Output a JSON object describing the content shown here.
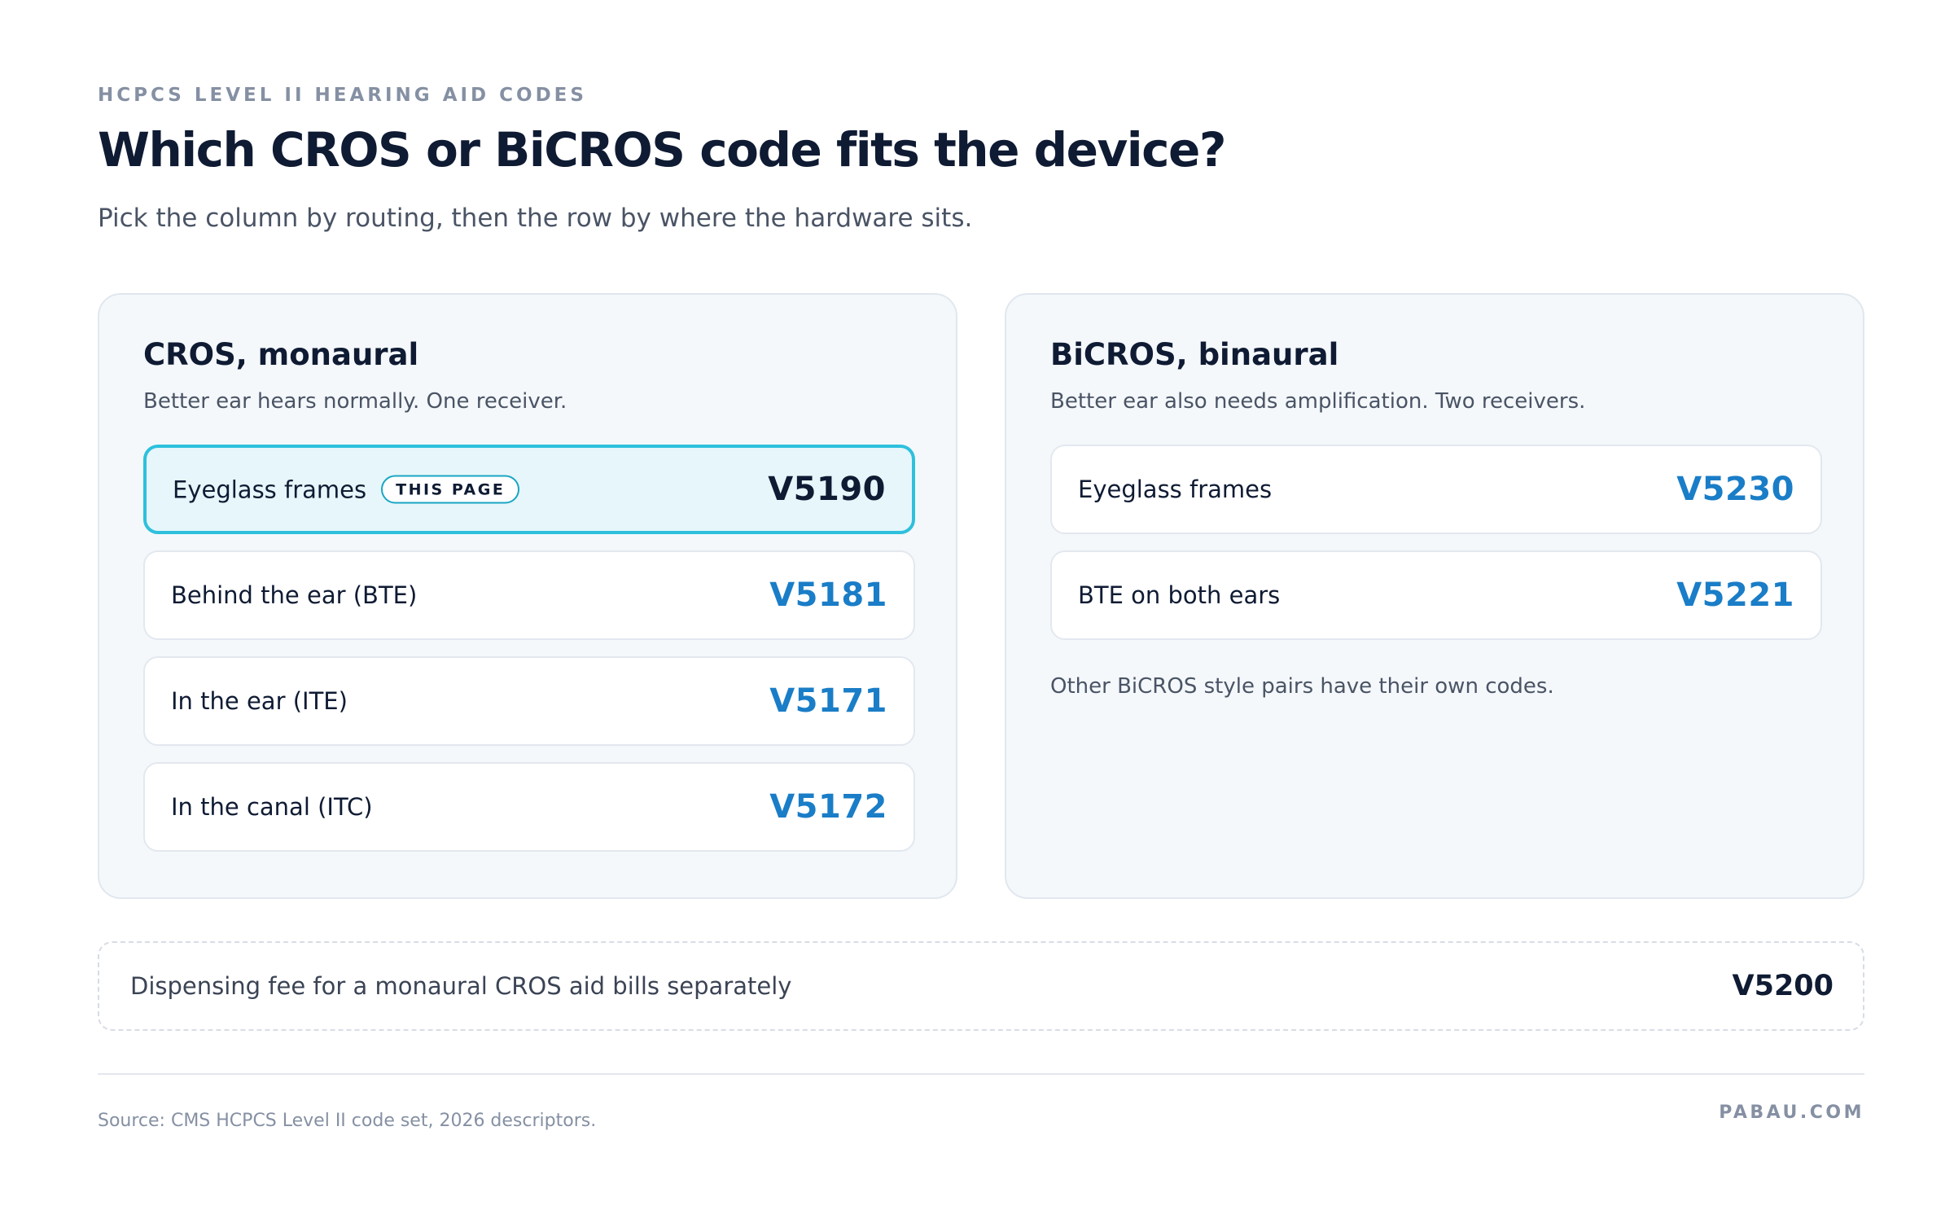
{
  "header": {
    "eyebrow": "HCPCS LEVEL II HEARING AID CODES",
    "title": "Which CROS or BiCROS code fits the device?",
    "subtitle": "Pick the column by routing, then the row by where the hardware sits."
  },
  "cros": {
    "title": "CROS, monaural",
    "description": "Better ear hears normally. One receiver.",
    "rows": [
      {
        "label": "Eyeglass frames",
        "badge": "THIS PAGE",
        "code": "V5190"
      },
      {
        "label": "Behind the ear (BTE)",
        "code": "V5181"
      },
      {
        "label": "In the ear (ITE)",
        "code": "V5171"
      },
      {
        "label": "In the canal (ITC)",
        "code": "V5172"
      }
    ]
  },
  "bicros": {
    "title": "BiCROS, binaural",
    "description": "Better ear also needs amplification. Two receivers.",
    "rows": [
      {
        "label": "Eyeglass frames",
        "code": "V5230"
      },
      {
        "label": "BTE on both ears",
        "code": "V5221"
      }
    ],
    "note": "Other BiCROS style pairs have their own codes."
  },
  "fee": {
    "label": "Dispensing fee for a monaural CROS aid bills separately",
    "code": "V5200"
  },
  "footer": {
    "source": "Source: CMS HCPCS Level II code set, 2026 descriptors.",
    "brand": "PABAU.COM"
  },
  "colors": {
    "navy": "#0f1b33",
    "code_blue": "#1a7dc7",
    "highlight_border": "#2ec0dd",
    "highlight_fill": "#e6f6fa",
    "panel_fill": "#f4f8fb",
    "muted": "#8590a3"
  }
}
